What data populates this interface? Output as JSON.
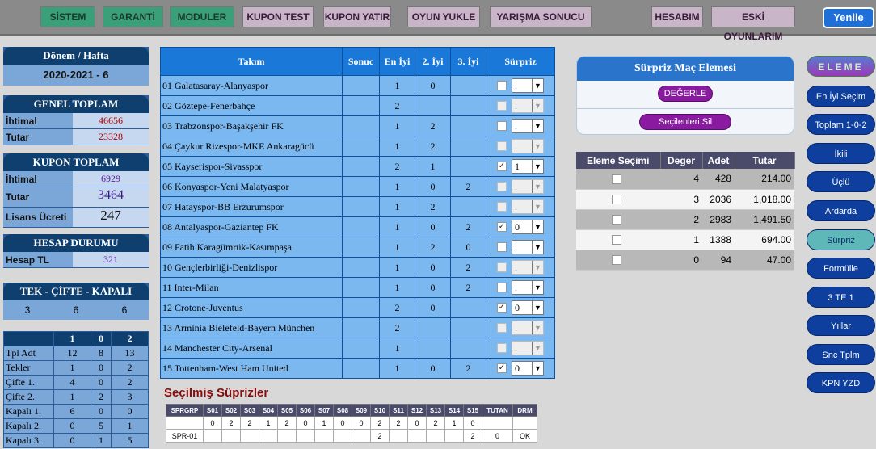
{
  "topbar": {
    "left": [
      "SİSTEM",
      "GARANTİ",
      "MODULER"
    ],
    "mid": [
      "KUPON TEST",
      "KUPON YATIR",
      "OYUN YUKLE",
      "YARIŞMA SONUCU"
    ],
    "right": [
      "HESABIM",
      "ESKİ OYUNLARIM"
    ],
    "yenile": "Yenile"
  },
  "donem": {
    "title": "Dönem / Hafta",
    "value": "2020-2021 - 6"
  },
  "genel": {
    "title": "GENEL TOPLAM",
    "rows": [
      {
        "label": "İhtimal",
        "value": "46656"
      },
      {
        "label": "Tutar",
        "value": "23328"
      }
    ]
  },
  "kupon": {
    "title": "KUPON TOPLAM",
    "rows": [
      {
        "label": "İhtimal",
        "value": "6929"
      },
      {
        "label": "Tutar",
        "value": "3464"
      },
      {
        "label": "Lisans Ücreti",
        "value": "247"
      }
    ]
  },
  "hesap": {
    "title": "HESAP DURUMU",
    "rows": [
      {
        "label": "Hesap TL",
        "value": "321"
      }
    ]
  },
  "tek": {
    "title": "TEK - ÇİFTE - KAPALI",
    "values": [
      "3",
      "6",
      "6"
    ]
  },
  "stats": {
    "header": [
      "",
      "1",
      "0",
      "2"
    ],
    "rows": [
      [
        "Tpl Adt",
        "12",
        "8",
        "13"
      ],
      [
        "Tekler",
        "1",
        "0",
        "2"
      ],
      [
        "Çifte   1.",
        "4",
        "0",
        "2"
      ],
      [
        "Çifte   2.",
        "1",
        "2",
        "3"
      ],
      [
        "Kapalı 1.",
        "6",
        "0",
        "0"
      ],
      [
        "Kapalı 2.",
        "0",
        "5",
        "1"
      ],
      [
        "Kapalı 3.",
        "0",
        "1",
        "5"
      ]
    ]
  },
  "main": {
    "headers": [
      "Takım",
      "Sonuc",
      "En İyi",
      "2. İyi",
      "3. İyi",
      "Sürpriz"
    ],
    "rows": [
      {
        "team": "01 Galatasaray-Alanyaspor",
        "sonuc": "",
        "e1": "1",
        "e2": "0",
        "e3": "",
        "checked": false,
        "sel": ".",
        "enabled": true
      },
      {
        "team": "02 Göztepe-Fenerbahçe",
        "sonuc": "",
        "e1": "2",
        "e2": "",
        "e3": "",
        "checked": false,
        "sel": ".",
        "enabled": false
      },
      {
        "team": "03 Trabzonspor-Başakşehir FK",
        "sonuc": "",
        "e1": "1",
        "e2": "2",
        "e3": "",
        "checked": false,
        "sel": ".",
        "enabled": true
      },
      {
        "team": "04 Çaykur Rizespor-MKE Ankaragücü",
        "sonuc": "",
        "e1": "1",
        "e2": "2",
        "e3": "",
        "checked": false,
        "sel": ".",
        "enabled": false
      },
      {
        "team": "05 Kayserispor-Sivasspor",
        "sonuc": "",
        "e1": "2",
        "e2": "1",
        "e3": "",
        "checked": true,
        "sel": "1",
        "enabled": true
      },
      {
        "team": "06 Konyaspor-Yeni Malatyaspor",
        "sonuc": "",
        "e1": "1",
        "e2": "0",
        "e3": "2",
        "checked": false,
        "sel": ".",
        "enabled": false
      },
      {
        "team": "07 Hatayspor-BB Erzurumspor",
        "sonuc": "",
        "e1": "1",
        "e2": "2",
        "e3": "",
        "checked": false,
        "sel": ".",
        "enabled": false
      },
      {
        "team": "08 Antalyaspor-Gaziantep FK",
        "sonuc": "",
        "e1": "1",
        "e2": "0",
        "e3": "2",
        "checked": true,
        "sel": "0",
        "enabled": true
      },
      {
        "team": "09 Fatih Karagümrük-Kasımpaşa",
        "sonuc": "",
        "e1": "1",
        "e2": "2",
        "e3": "0",
        "checked": false,
        "sel": ".",
        "enabled": true
      },
      {
        "team": "10 Gençlerbirliği-Denizlispor",
        "sonuc": "",
        "e1": "1",
        "e2": "0",
        "e3": "2",
        "checked": false,
        "sel": ".",
        "enabled": false
      },
      {
        "team": "11 Inter-Milan",
        "sonuc": "",
        "e1": "1",
        "e2": "0",
        "e3": "2",
        "checked": false,
        "sel": ".",
        "enabled": true
      },
      {
        "team": "12 Crotone-Juventus",
        "sonuc": "",
        "e1": "2",
        "e2": "0",
        "e3": "",
        "checked": true,
        "sel": "0",
        "enabled": true
      },
      {
        "team": "13 Arminia Bielefeld-Bayern München",
        "sonuc": "",
        "e1": "2",
        "e2": "",
        "e3": "",
        "checked": false,
        "sel": ".",
        "enabled": false
      },
      {
        "team": "14 Manchester City-Arsenal",
        "sonuc": "",
        "e1": "1",
        "e2": "",
        "e3": "",
        "checked": false,
        "sel": ".",
        "enabled": false
      },
      {
        "team": "15 Tottenham-West Ham United",
        "sonuc": "",
        "e1": "1",
        "e2": "0",
        "e3": "2",
        "checked": true,
        "sel": "0",
        "enabled": true
      }
    ]
  },
  "secilmis": {
    "title": "Seçilmiş Süprizler",
    "headers": [
      "SPRGRP",
      "S01",
      "S02",
      "S03",
      "S04",
      "S05",
      "S06",
      "S07",
      "S08",
      "S09",
      "S10",
      "S11",
      "S12",
      "S13",
      "S14",
      "S15",
      "TUTAN",
      "DRM"
    ],
    "row1": [
      "",
      "0",
      "2",
      "2",
      "1",
      "2",
      "0",
      "1",
      "0",
      "0",
      "2",
      "2",
      "0",
      "2",
      "1",
      "0",
      "",
      ""
    ],
    "row2": [
      "SPR-01",
      "",
      "",
      "",
      "",
      "",
      "",
      "",
      "",
      "",
      "2",
      "",
      "",
      "",
      "",
      "2",
      "0",
      "OK"
    ]
  },
  "surpriz": {
    "title": "Sürpriz Maç Elemesi",
    "degerle": "DEĞERLE",
    "sil": "Seçilenleri Sil"
  },
  "elim": {
    "headers": [
      "Eleme Seçimi",
      "Deger",
      "Adet",
      "Tutar"
    ],
    "rows": [
      [
        "4",
        "428",
        "214.00"
      ],
      [
        "3",
        "2036",
        "1,018.00"
      ],
      [
        "2",
        "2983",
        "1,491.50"
      ],
      [
        "1",
        "1388",
        "694.00"
      ],
      [
        "0",
        "94",
        "47.00"
      ]
    ]
  },
  "rightbtns": [
    "ELEME",
    "En İyi Seçim",
    "Toplam 1-0-2",
    "İkili",
    "Üçlü",
    "Ardarda",
    "Sürpriz",
    "Formülle",
    "3 TE 1",
    "Yıllar",
    "Snc Tplm",
    "KPN YZD"
  ]
}
